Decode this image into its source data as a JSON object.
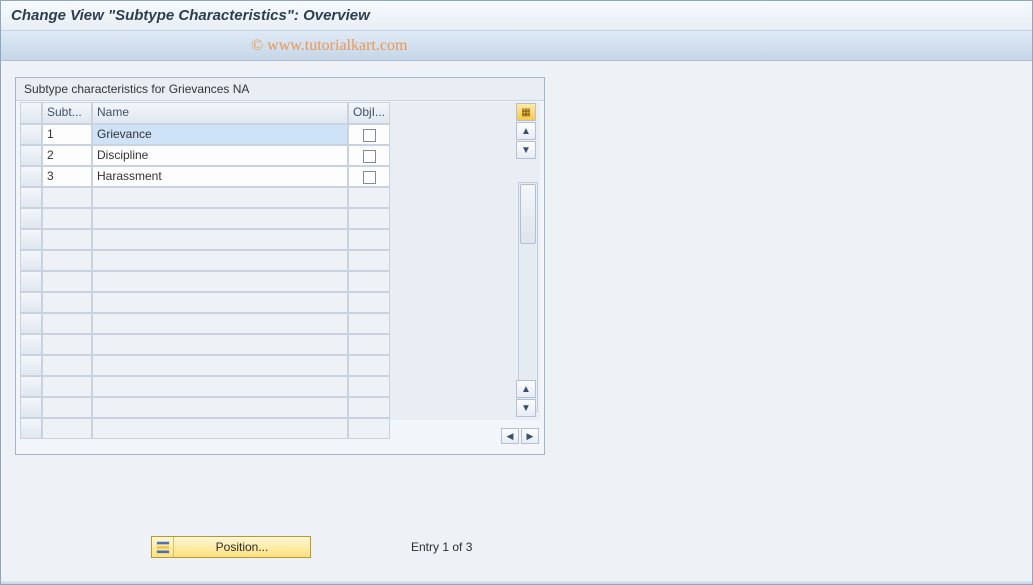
{
  "header": {
    "title": "Change View \"Subtype Characteristics\": Overview",
    "watermark": "© www.tutorialkart.com"
  },
  "grid": {
    "title": "Subtype characteristics for Grievances NA",
    "columns": {
      "sel": "",
      "sub": "Subt...",
      "name": "Name",
      "obj": "ObjI..."
    },
    "rows": [
      {
        "sub": "1",
        "name": "Grievance",
        "obj": false,
        "highlight": true
      },
      {
        "sub": "2",
        "name": "Discipline",
        "obj": false,
        "highlight": false
      },
      {
        "sub": "3",
        "name": "Harassment",
        "obj": false,
        "highlight": false
      }
    ],
    "empty_rows": 12,
    "icons": {
      "config": "▦",
      "up": "▲",
      "down": "▼",
      "left": "◀",
      "right": "▶"
    }
  },
  "footer": {
    "position_button": "Position...",
    "entry_text": "Entry 1 of 3"
  }
}
